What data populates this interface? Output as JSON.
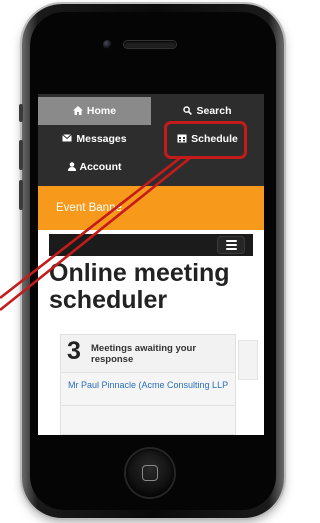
{
  "nav": {
    "home": "Home",
    "search": "Search",
    "messages": "Messages",
    "schedule": "Schedule",
    "account": "Account"
  },
  "banner": {
    "text": "Event Banne"
  },
  "page": {
    "title": "Online meeting scheduler"
  },
  "meetings_card": {
    "count": "3",
    "label": "Meetings awaiting your response",
    "first_item": "Mr Paul Pinnacle (Acme Consulting LLP"
  },
  "colors": {
    "navbar": "#2d2d2d",
    "nav_active": "#8a8a8a",
    "banner": "#f79a1b",
    "annotation": "#c41b1b",
    "link": "#2a6ebb"
  },
  "icons": [
    "home-icon",
    "search-icon",
    "messages-icon",
    "schedule-icon",
    "account-icon",
    "hamburger-menu-icon"
  ]
}
